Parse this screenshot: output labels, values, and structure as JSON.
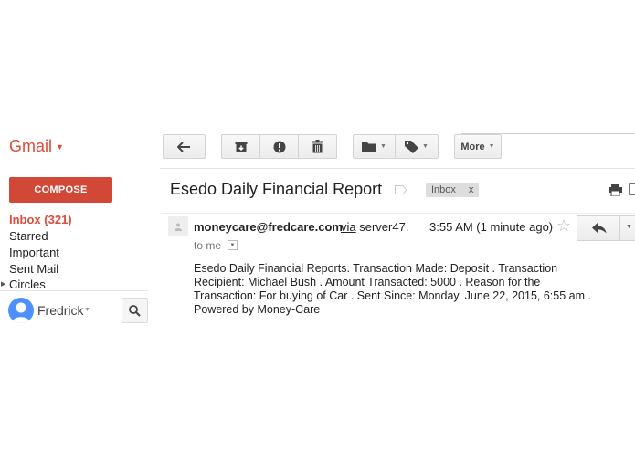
{
  "app": {
    "name": "Gmail"
  },
  "toolbar": {
    "back_icon": "back-arrow-icon",
    "archive_icon": "archive-icon",
    "spam_icon": "report-spam-icon",
    "delete_icon": "trash-icon",
    "move_icon": "folder-icon",
    "labels_icon": "label-tag-icon",
    "more_label": "More"
  },
  "sidebar": {
    "compose_label": "COMPOSE",
    "items": [
      {
        "label": "Inbox (321)"
      },
      {
        "label": "Starred"
      },
      {
        "label": "Important"
      },
      {
        "label": "Sent Mail"
      },
      {
        "label": "Circles"
      }
    ],
    "user_name": "Fredrick"
  },
  "message": {
    "subject": "Esedo Daily Financial Report",
    "label_chip": "Inbox",
    "label_chip_remove": "x",
    "sender": "moneycare@fredcare.com",
    "via_label": "via",
    "via_server": "server47.",
    "time": "3:55 AM (1 minute ago)",
    "to": "to me",
    "body_lines": [
      "Esedo Daily Financial Reports.   Transaction Made: Deposit .   Transaction",
      "Recipient:  Michael Bush .  Amount Transacted:  5000 .   Reason for the",
      "Transaction:  For buying of Car .  Sent Since: Monday, June 22, 2015, 6:55 am  .",
      "Powered by Money-Care"
    ]
  },
  "colors": {
    "brand": "#dd4b39",
    "compose_bg": "#d14836",
    "avatar": "#4d90fe"
  }
}
